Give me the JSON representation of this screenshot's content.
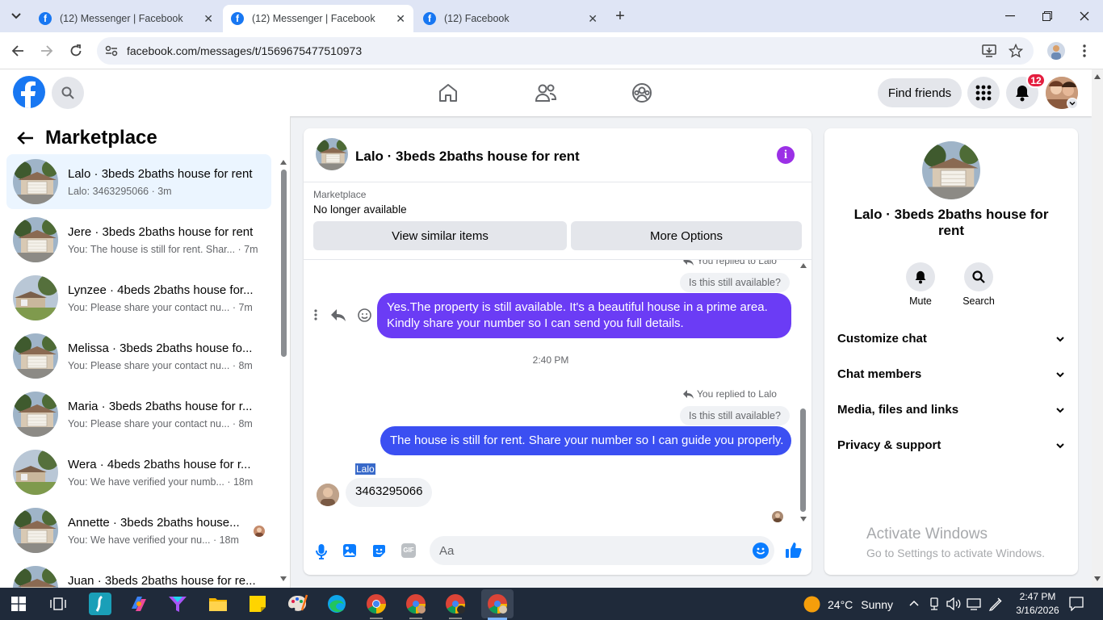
{
  "browser": {
    "tabs": [
      {
        "title": "(12) Messenger | Facebook",
        "active": false
      },
      {
        "title": "(12) Messenger | Facebook",
        "active": true
      },
      {
        "title": "(12) Facebook",
        "active": false
      }
    ],
    "url": "facebook.com/messages/t/1569675477510973"
  },
  "header": {
    "find_friends": "Find friends",
    "notification_count": "12"
  },
  "sidebar": {
    "title": "Marketplace",
    "conversations": [
      {
        "name": "Lalo · 3beds 2baths house for rent",
        "preview": "Lalo: 3463295066 · 3m",
        "selected": true
      },
      {
        "name": "Jere · 3beds 2baths house for rent",
        "preview": "You: The house is still for rent. Shar... · 7m"
      },
      {
        "name": "Lynzee · 4beds 2baths house for...",
        "preview": "You: Please share your contact nu... · 7m"
      },
      {
        "name": "Melissa · 3beds 2baths house fo...",
        "preview": "You: Please share your contact nu... · 8m"
      },
      {
        "name": "Maria · 3beds 2baths house for r...",
        "preview": "You: Please share your contact nu... · 8m"
      },
      {
        "name": "Wera · 4beds 2baths house for r...",
        "preview": "You: We have verified your numb... · 18m"
      },
      {
        "name": "Annette · 3beds 2baths house...",
        "preview": "You: We have verified your nu... · 18m"
      },
      {
        "name": "Juan · 3beds 2baths house for re...",
        "preview": ""
      }
    ]
  },
  "chat": {
    "title": "Lalo · 3beds 2baths house for rent",
    "listing_label": "Marketplace",
    "listing_status": "No longer available",
    "view_similar": "View similar items",
    "more_options": "More Options",
    "replied_label_1": "You replied to Lalo",
    "quote_1": "Is this still available?",
    "msg_1": "Yes.The property is still available. It's a beautiful house in a prime area. Kindly share your number so I can send you full details.",
    "timestamp": "2:40 PM",
    "replied_label_2": "You replied to Lalo",
    "quote_2": "Is this still available?",
    "msg_2": "The house is still for rent. Share your number so I can guide you properly.",
    "sender_name": "Lalo",
    "incoming_msg": "3463295066",
    "input_placeholder": "Aa",
    "gif_label": "GIF"
  },
  "details": {
    "name": "Lalo · 3beds 2baths house for rent",
    "mute": "Mute",
    "search": "Search",
    "sections": [
      "Customize chat",
      "Chat members",
      "Media, files and links",
      "Privacy & support"
    ]
  },
  "watermark": {
    "title": "Activate Windows",
    "subtitle": "Go to Settings to activate Windows."
  },
  "taskbar": {
    "temperature": "24°C",
    "weather": "Sunny",
    "time": "2:47 PM",
    "date": "3/16/2026"
  },
  "colors": {
    "fb_blue": "#1877f2",
    "bubble_purple": "#6b3cf5",
    "bubble_blue": "#3b4ff2",
    "selected_row": "#ebf5ff"
  }
}
